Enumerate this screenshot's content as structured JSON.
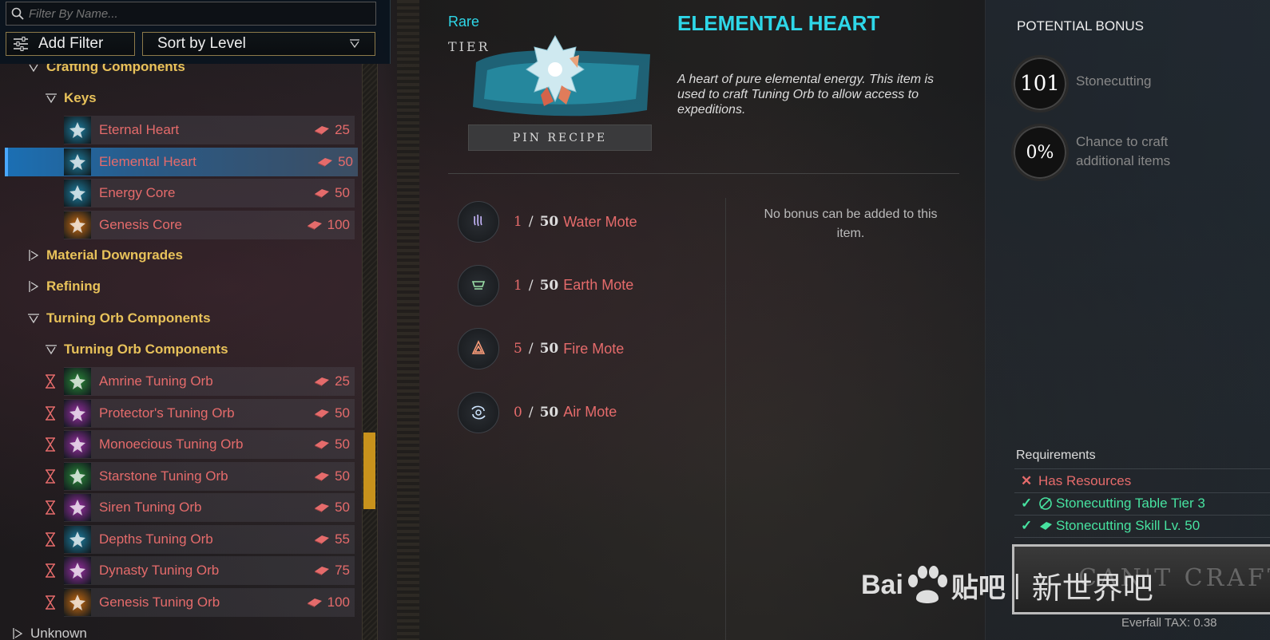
{
  "filter": {
    "placeholder": "Filter By Name..."
  },
  "buttons": {
    "add_filter": "Add Filter",
    "sort": "Sort by Level"
  },
  "tree": {
    "crafting_components": "Crafting Components",
    "keys": "Keys",
    "material_downgrades": "Material Downgrades",
    "refining": "Refining",
    "tuning_group": "Turning Orb Components",
    "tuning_sub": "Turning Orb Components",
    "bottom_partial": "Unknown"
  },
  "keys_items": [
    {
      "name": "Eternal Heart",
      "level": "25",
      "color": "#1e7ea0"
    },
    {
      "name": "Elemental Heart",
      "level": "50",
      "color": "#1e7ea0",
      "selected": true
    },
    {
      "name": "Energy Core",
      "level": "50",
      "color": "#1e7ea0"
    },
    {
      "name": "Genesis Core",
      "level": "100",
      "color": "#c96a10"
    }
  ],
  "tuning_items": [
    {
      "name": "Amrine Tuning Orb",
      "level": "25",
      "color": "#2b8a3a"
    },
    {
      "name": "Protector's Tuning Orb",
      "level": "50",
      "color": "#9a2fa4"
    },
    {
      "name": "Monoecious Tuning Orb",
      "level": "50",
      "color": "#9a2fa4"
    },
    {
      "name": "Starstone Tuning Orb",
      "level": "50",
      "color": "#2b8a3a"
    },
    {
      "name": "Siren Tuning Orb",
      "level": "50",
      "color": "#9a2fa4"
    },
    {
      "name": "Depths Tuning Orb",
      "level": "55",
      "color": "#1e7ea0"
    },
    {
      "name": "Dynasty Tuning Orb",
      "level": "75",
      "color": "#9a2fa4"
    },
    {
      "name": "Genesis Tuning Orb",
      "level": "100",
      "color": "#c96a10"
    }
  ],
  "item": {
    "rarity": "Rare",
    "tier": "TIER",
    "title": "ELEMENTAL HEART",
    "description": "A heart of pure elemental energy. This item is used to craft Tuning Orb to allow access to expeditions.",
    "pin_recipe": "PIN RECIPE"
  },
  "materials": [
    {
      "have": "1",
      "need": "50",
      "name": "Water Mote",
      "icon": "water-mote-icon"
    },
    {
      "have": "1",
      "need": "50",
      "name": "Earth Mote",
      "icon": "earth-mote-icon"
    },
    {
      "have": "5",
      "need": "50",
      "name": "Fire Mote",
      "icon": "fire-mote-icon"
    },
    {
      "have": "0",
      "need": "50",
      "name": "Air Mote",
      "icon": "air-mote-icon"
    }
  ],
  "no_bonus": "No bonus can be added to this item.",
  "potential": {
    "title": "POTENTIAL BONUS",
    "skill_value": "101",
    "skill_label": "Stonecutting",
    "chance_value": "0%",
    "chance_label": "Chance to craft additional items"
  },
  "requirements": {
    "title": "Requirements",
    "items": [
      {
        "text": "Has Resources",
        "met": false
      },
      {
        "text": "Stonecutting Table Tier 3",
        "met": true
      },
      {
        "text": "Stonecutting Skill Lv. 50",
        "met": true
      }
    ]
  },
  "craft_button": "CAN'T CRAFT",
  "tax": "Everfall TAX: 0.38",
  "watermark": {
    "brand_a": "Bai",
    "brand_b": "贴吧",
    "sep": "|",
    "cn": "新世界吧"
  },
  "colors": {
    "accent": "#2ed7e8",
    "missing": "#e56b6b",
    "ok": "#47e2a0",
    "category": "#e8c25a"
  }
}
